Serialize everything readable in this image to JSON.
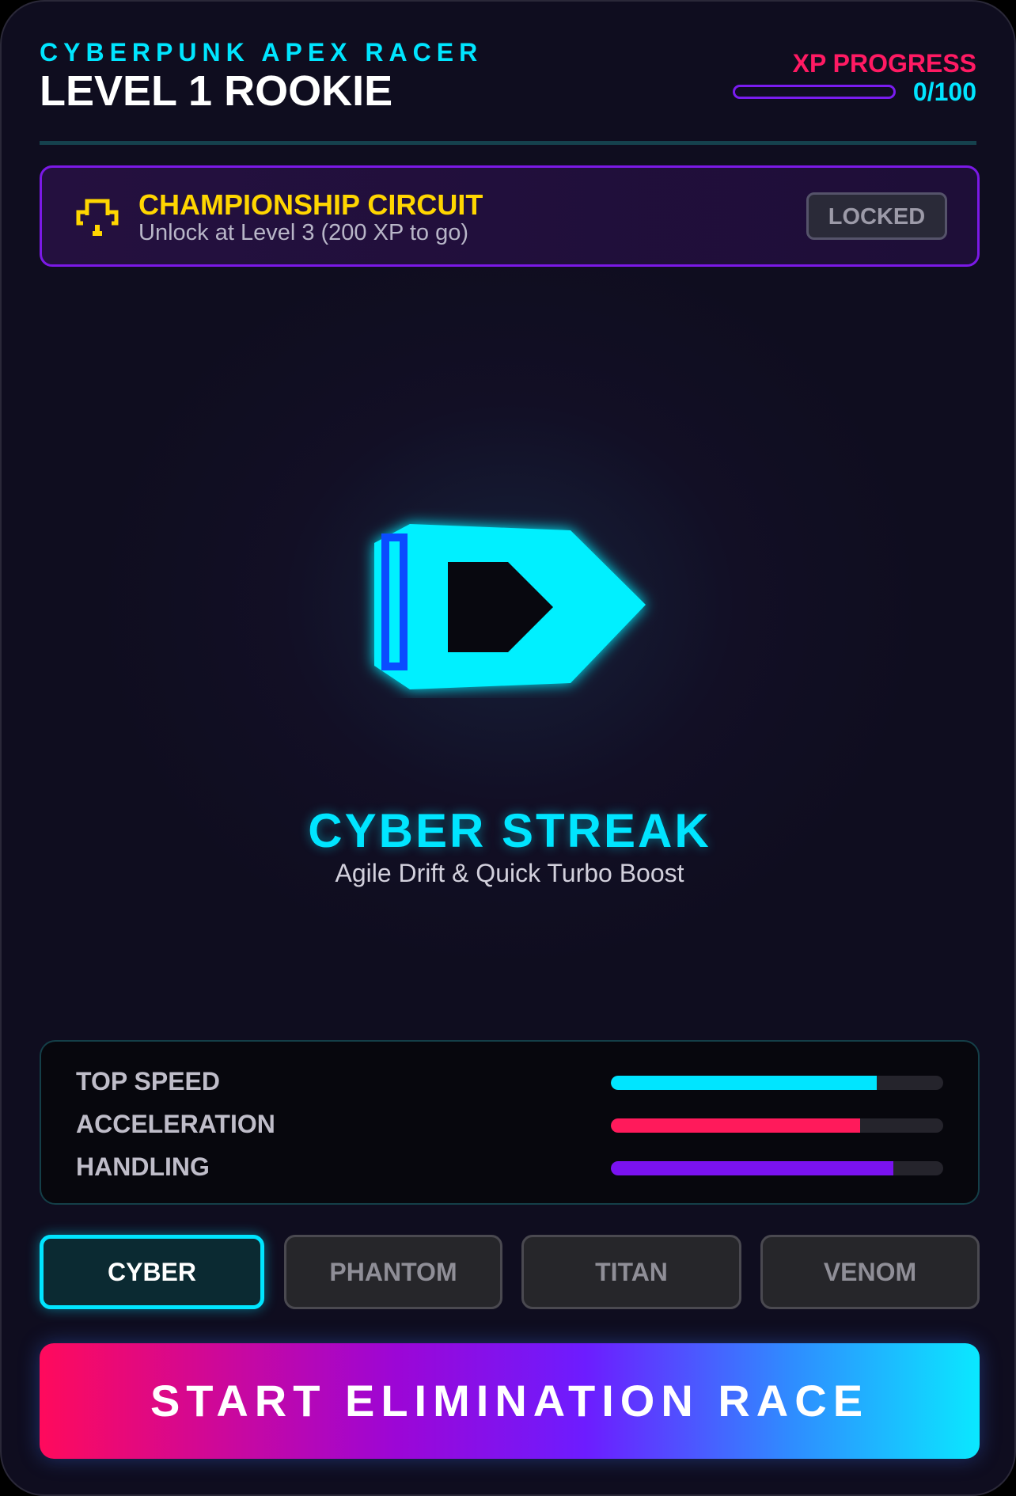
{
  "header": {
    "game_title": "CYBERPUNK APEX RACER",
    "level_title": "LEVEL 1 ROOKIE",
    "xp_label": "XP PROGRESS",
    "xp_value": "0/100",
    "xp_progress_fraction": 0
  },
  "championship": {
    "icon": "trophy-icon",
    "title": "CHAMPIONSHIP CIRCUIT",
    "subtitle": "Unlock at Level 3 (200 XP to go)",
    "status": "LOCKED"
  },
  "car": {
    "icon": "race-car-icon",
    "name": "CYBER STREAK",
    "description": "Agile Drift & Quick Turbo Boost"
  },
  "stats": [
    {
      "label": "TOP SPEED",
      "value": 0.8,
      "color": "#00e5ff"
    },
    {
      "label": "ACCELERATION",
      "value": 0.75,
      "color": "#ff1a5b"
    },
    {
      "label": "HANDLING",
      "value": 0.85,
      "color": "#7a12f0"
    }
  ],
  "car_tabs": [
    {
      "label": "CYBER",
      "active": true
    },
    {
      "label": "PHANTOM",
      "active": false
    },
    {
      "label": "TITAN",
      "active": false
    },
    {
      "label": "VENOM",
      "active": false
    }
  ],
  "start_button": {
    "label": "START ELIMINATION RACE"
  },
  "colors": {
    "accent_cyan": "#00e5ff",
    "accent_pink": "#ff1a63",
    "accent_purple": "#7a1cf0",
    "accent_yellow": "#ffd600"
  }
}
